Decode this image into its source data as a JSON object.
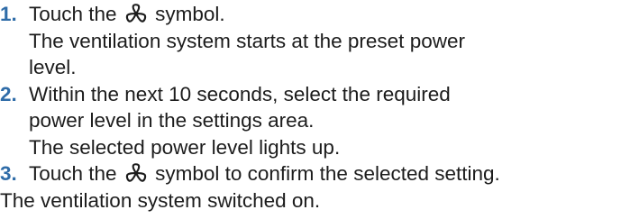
{
  "colors": {
    "step_number": "#2f6ca8",
    "text": "#1c1c1c"
  },
  "icons": {
    "fan": "fan-icon"
  },
  "steps": [
    {
      "number": "1.",
      "instruction_before_icon": "Touch the",
      "instruction_after_icon": "symbol.",
      "result_lines": [
        "The ventilation system starts at the preset power",
        "level."
      ]
    },
    {
      "number": "2.",
      "instruction_lines": [
        "Within the next 10 seconds, select the required",
        "power level in the settings area."
      ],
      "result": "The selected power level lights up."
    },
    {
      "number": "3.",
      "instruction_before_icon": "Touch the",
      "instruction_after_icon": "symbol to confirm the selected setting."
    }
  ],
  "final_result": "The ventilation system switched on."
}
